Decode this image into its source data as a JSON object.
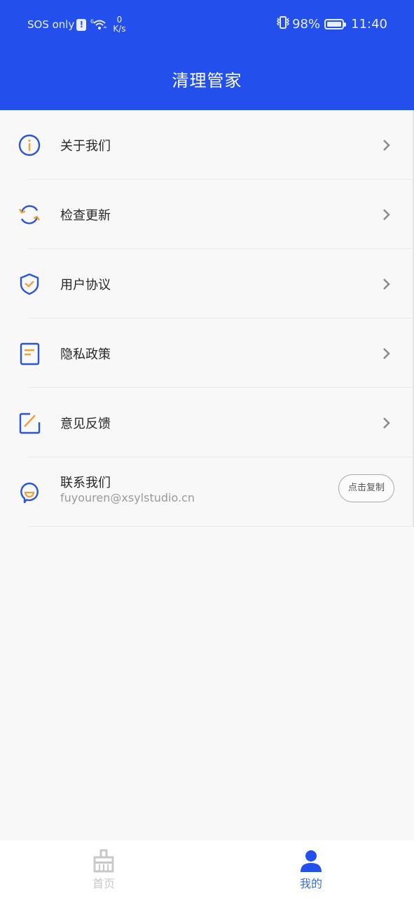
{
  "status_bar": {
    "carrier": "SOS only",
    "sim_alert": "!",
    "wifi_generation": "6",
    "net_speed_value": "0",
    "net_speed_unit": "K/s",
    "battery_percent": "98%",
    "battery_level": 0.98,
    "time": "11:40"
  },
  "header": {
    "title": "清理管家"
  },
  "colors": {
    "primary": "#2350ec",
    "accent_orange": "#e8a33d",
    "icon_blue": "#2b55d6"
  },
  "menu": {
    "items": [
      {
        "label": "关于我们",
        "icon": "info-icon"
      },
      {
        "label": "检查更新",
        "icon": "refresh-icon"
      },
      {
        "label": "用户协议",
        "icon": "shield-check-icon"
      },
      {
        "label": "隐私政策",
        "icon": "document-icon"
      },
      {
        "label": "意见反馈",
        "icon": "edit-icon"
      }
    ],
    "contact": {
      "label": "联系我们",
      "email": "fuyouren@xsylstudio.cn",
      "copy_button": "点击复制",
      "icon": "chat-smile-icon"
    }
  },
  "tabbar": {
    "tabs": [
      {
        "label": "首页",
        "icon": "broom-icon",
        "active": false
      },
      {
        "label": "我的",
        "icon": "person-icon",
        "active": true
      }
    ]
  }
}
